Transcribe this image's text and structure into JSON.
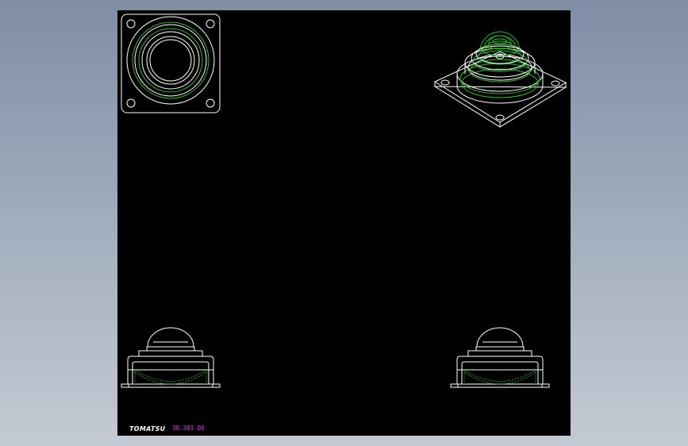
{
  "drawing": {
    "brand": "TOMATSU",
    "part_code": "38.383.00"
  },
  "colors": {
    "background": "#000000",
    "outline": "#ffffff",
    "hidden": "#1fbf1f",
    "code": "#e040e0"
  }
}
